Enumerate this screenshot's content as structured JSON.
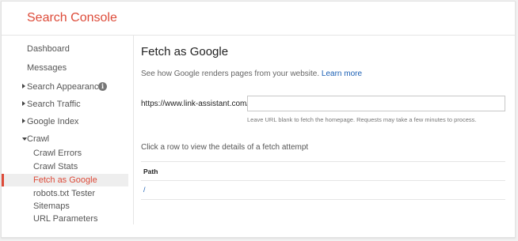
{
  "header": {
    "title": "Search Console"
  },
  "sidebar": {
    "items": [
      {
        "label": "Dashboard"
      },
      {
        "label": "Messages"
      },
      {
        "label": "Search Appearance",
        "icon": "info-icon"
      },
      {
        "label": "Search Traffic"
      },
      {
        "label": "Google Index"
      },
      {
        "label": "Crawl",
        "expanded": true
      },
      {
        "label": "Crawl Errors"
      },
      {
        "label": "Crawl Stats"
      },
      {
        "label": "Fetch as Google",
        "active": true
      },
      {
        "label": "robots.txt Tester"
      },
      {
        "label": "Sitemaps"
      },
      {
        "label": "URL Parameters"
      }
    ]
  },
  "main": {
    "title": "Fetch as Google",
    "description": "See how Google renders pages from your website.",
    "learn_more": "Learn more",
    "url_prefix": "https://www.link-assistant.com/",
    "url_value": "",
    "hint": "Leave URL blank to fetch the homepage. Requests may take a few minutes to process.",
    "click_row_text": "Click a row to view the details of a fetch attempt",
    "table": {
      "columns": [
        "Path"
      ],
      "rows": [
        {
          "path": "/"
        }
      ]
    }
  },
  "colors": {
    "brand": "#dd4b39",
    "link": "#1a5fb4",
    "active_bg": "#eeeeee"
  }
}
